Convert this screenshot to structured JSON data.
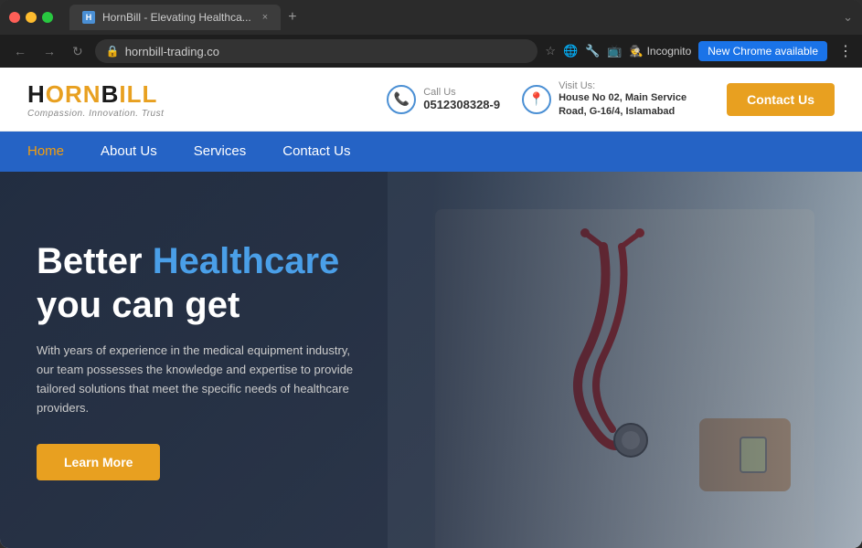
{
  "browser": {
    "tab_title": "HornBill - Elevating Healthca...",
    "url": "hornbill-trading.co",
    "new_tab_icon": "+",
    "close_icon": "×",
    "back_icon": "←",
    "forward_icon": "→",
    "reload_icon": "↻",
    "incognito_label": "Incognito",
    "chrome_update_label": "New Chrome available",
    "star_icon": "☆",
    "menu_dots": "⋮"
  },
  "header": {
    "logo_part1": "H",
    "logo_part2": "ORN",
    "logo_part3": "B",
    "logo_part4": "ILL",
    "logo_full": "HORNBILL",
    "tagline": "Compassion. Innovation. Trust",
    "call_label": "Call Us",
    "phone": "0512308328-9",
    "visit_label": "Visit Us:",
    "address": "House No 02, Main Service Road, G-16/4, Islamabad",
    "contact_btn": "Contact Us"
  },
  "nav": {
    "items": [
      {
        "label": "Home",
        "active": true
      },
      {
        "label": "About Us",
        "active": false
      },
      {
        "label": "Services",
        "active": false
      },
      {
        "label": "Contact Us",
        "active": false
      }
    ]
  },
  "hero": {
    "title_part1": "Better ",
    "title_highlight": "Healthcare",
    "title_part2": "you can get",
    "description": "With years of experience in the medical equipment industry, our team possesses the knowledge and expertise to provide tailored solutions that meet the specific needs of healthcare providers.",
    "cta_label": "Learn More"
  }
}
